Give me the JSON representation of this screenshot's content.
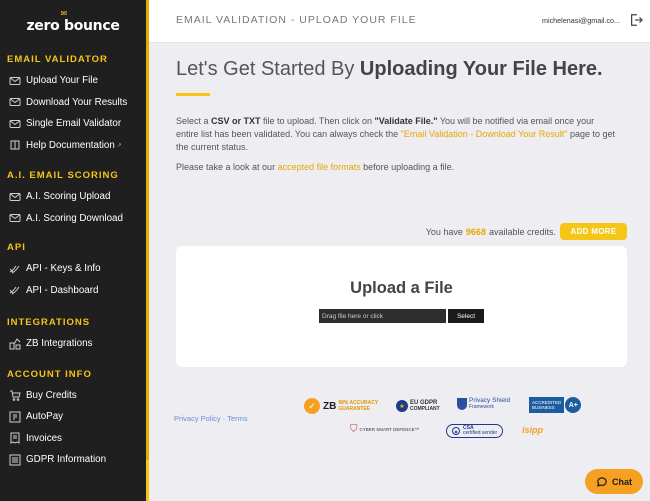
{
  "brand": {
    "logo_text": "zero bounce"
  },
  "colors": {
    "accent": "#f5c518",
    "sidebar_bg": "#1f1f1f",
    "link": "#e6a800",
    "footer_link": "#6a8fd0"
  },
  "sidebar": {
    "sections": [
      {
        "header": "EMAIL VALIDATOR",
        "items": [
          {
            "label": "Upload Your File",
            "icon": "envelope-icon"
          },
          {
            "label": "Download Your Results",
            "icon": "envelope-icon"
          },
          {
            "label": "Single Email Validator",
            "icon": "envelope-icon"
          },
          {
            "label": "Help Documentation",
            "icon": "book-icon",
            "external": true
          }
        ]
      },
      {
        "header": "A.I. EMAIL SCORING",
        "items": [
          {
            "label": "A.I. Scoring Upload",
            "icon": "envelope-check-icon"
          },
          {
            "label": "A.I. Scoring Download",
            "icon": "envelope-check-icon"
          }
        ]
      },
      {
        "header": "API",
        "items": [
          {
            "label": "API - Keys & Info",
            "icon": "key-icon"
          },
          {
            "label": "API - Dashboard",
            "icon": "key-icon"
          }
        ]
      },
      {
        "header": "INTEGRATIONS",
        "items": [
          {
            "label": "ZB Integrations",
            "icon": "integrations-icon"
          }
        ]
      },
      {
        "header": "ACCOUNT INFO",
        "items": [
          {
            "label": "Buy Credits",
            "icon": "cart-icon"
          },
          {
            "label": "AutoPay",
            "icon": "autopay-icon"
          },
          {
            "label": "Invoices",
            "icon": "invoice-icon"
          },
          {
            "label": "GDPR Information",
            "icon": "gdpr-icon"
          }
        ]
      }
    ],
    "external_marker": "↗"
  },
  "topbar": {
    "title": "EMAIL VALIDATION - UPLOAD YOUR FILE",
    "user_email": "michelenasi@gmail.co..."
  },
  "main": {
    "heading_plain": "Let's Get Started By ",
    "heading_bold": "Uploading Your File Here.",
    "desc_1": "Select a ",
    "desc_2": "CSV or TXT",
    "desc_3": " file to upload. Then click on ",
    "desc_4": "\"Validate File.\"",
    "desc_5": " You will be notified via email once your entire list has been validated. You can always check the ",
    "desc_link": "\"Email Validation - Download Your Result\"",
    "desc_6": " page to get the current status.",
    "formats_1": "Please take a look at our ",
    "formats_link": "accepted file formats",
    "formats_2": " before uploading a file.",
    "credits_1": "You have",
    "credits_num": "9668",
    "credits_2": "available credits.",
    "add_more": "ADD MORE",
    "upload_title": "Upload a File",
    "drop_placeholder": "Drag file here or click",
    "select_label": "Select"
  },
  "footer": {
    "privacy": "Privacy Policy",
    "terms": "Terms",
    "badges": {
      "zb_mark": "ZB",
      "zb_text_1": "98% ACCURACY",
      "zb_text_2": "GUARANTEE",
      "gdpr_1": "EU GDPR",
      "gdpr_2": "COMPLIANT",
      "privacy_shield_1": "Privacy Shield",
      "privacy_shield_2": "Framework",
      "bbb_1": "ACCREDITED",
      "bbb_2": "BUSINESS",
      "bbb_grade": "A+",
      "cyber": "CYBER SMART DEFENCE™",
      "csa_1": "CSA",
      "csa_2": "certified sender",
      "isipp": "isipp"
    }
  },
  "chat": {
    "label": "Chat"
  }
}
